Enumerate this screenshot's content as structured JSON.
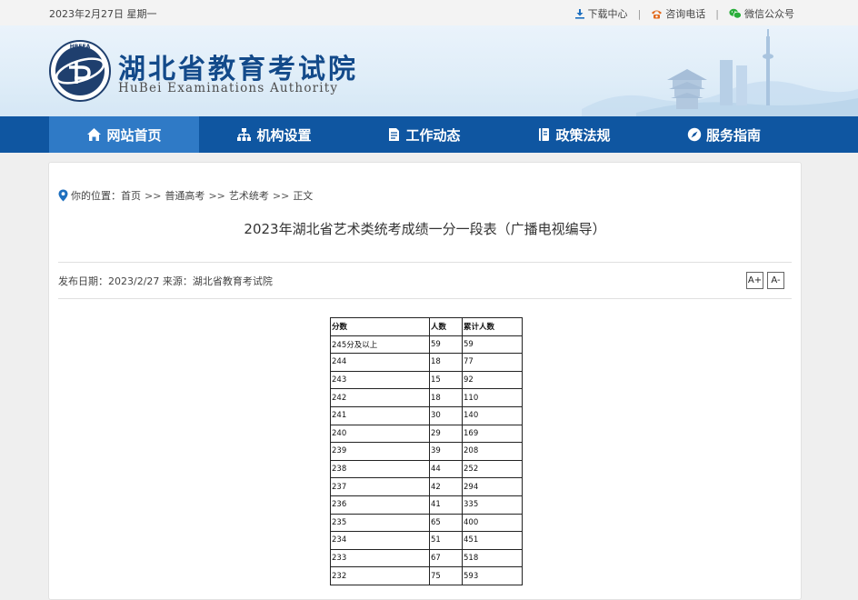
{
  "topbar": {
    "date": "2023年2月27日 星期一",
    "links": [
      {
        "label": "下载中心",
        "icon": "download-icon"
      },
      {
        "label": "咨询电话",
        "icon": "phone-icon"
      },
      {
        "label": "微信公众号",
        "icon": "wechat-icon"
      }
    ],
    "separator": "|"
  },
  "header": {
    "title": "湖北省教育考试院",
    "subtitle": "HuBei Examinations Authority",
    "logo_text": "HBEEA"
  },
  "nav": {
    "items": [
      {
        "label": "网站首页",
        "icon": "home-icon"
      },
      {
        "label": "机构设置",
        "icon": "org-chart-icon"
      },
      {
        "label": "工作动态",
        "icon": "document-icon"
      },
      {
        "label": "政策法规",
        "icon": "book-icon"
      },
      {
        "label": "服务指南",
        "icon": "compass-icon"
      }
    ]
  },
  "breadcrumb": {
    "prefix": "你的位置：",
    "items": [
      "首页",
      "普通高考",
      "艺术统考",
      "正文"
    ],
    "separator": ">>"
  },
  "article": {
    "title": "2023年湖北省艺术类统考成绩一分一段表（广播电视编导）",
    "meta": "发布日期：2023/2/27 来源：湖北省教育考试院",
    "font_increase": "A+",
    "font_decrease": "A-"
  },
  "table": {
    "headers": [
      "分数",
      "人数",
      "累计人数"
    ],
    "rows": [
      [
        "245分及以上",
        "59",
        "59"
      ],
      [
        "244",
        "18",
        "77"
      ],
      [
        "243",
        "15",
        "92"
      ],
      [
        "242",
        "18",
        "110"
      ],
      [
        "241",
        "30",
        "140"
      ],
      [
        "240",
        "29",
        "169"
      ],
      [
        "239",
        "39",
        "208"
      ],
      [
        "238",
        "44",
        "252"
      ],
      [
        "237",
        "42",
        "294"
      ],
      [
        "236",
        "41",
        "335"
      ],
      [
        "235",
        "65",
        "400"
      ],
      [
        "234",
        "51",
        "451"
      ],
      [
        "233",
        "67",
        "518"
      ],
      [
        "232",
        "75",
        "593"
      ]
    ]
  },
  "colors": {
    "nav_bg": "#0f56a1",
    "nav_active": "#2f7ac6",
    "title_blue": "#134a8a"
  }
}
